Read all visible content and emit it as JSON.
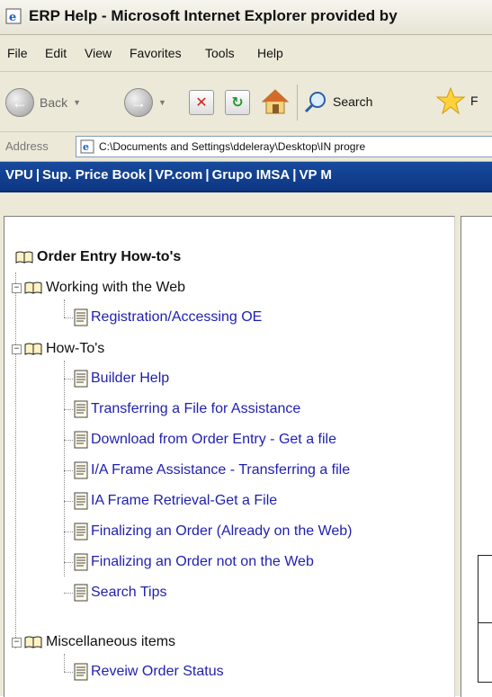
{
  "window": {
    "title": "ERP Help - Microsoft Internet Explorer provided by"
  },
  "menu": [
    "File",
    "Edit",
    "View",
    "Favorites",
    "Tools",
    "Help"
  ],
  "toolbar": {
    "back_label": "Back",
    "search_label": "Search",
    "favorites_label": "F"
  },
  "address": {
    "label": "Address",
    "value": "C:\\Documents and Settings\\ddeleray\\Desktop\\IN progre"
  },
  "navbar": {
    "links": [
      "VPU",
      "Sup. Price Book",
      "VP.com",
      "Grupo IMSA",
      "VP M"
    ],
    "separator": "|"
  },
  "toc": {
    "root": "Order Entry How-to's",
    "sections": [
      {
        "label": "Working with the Web",
        "items": [
          "Registration/Accessing OE"
        ]
      },
      {
        "label": "How-To's",
        "items": [
          "Builder Help",
          "Transferring a File for Assistance",
          "Download from Order Entry - Get a file",
          "I/A Frame Assistance - Transferring a file",
          "IA Frame Retrieval-Get a File",
          "Finalizing an Order (Already on the Web)",
          "Finalizing an Order not on the Web",
          "Search Tips"
        ]
      },
      {
        "label": "Miscellaneous items",
        "items": [
          "Reveiw Order Status"
        ]
      }
    ]
  },
  "icons": {
    "expanded_glyph": "−"
  }
}
